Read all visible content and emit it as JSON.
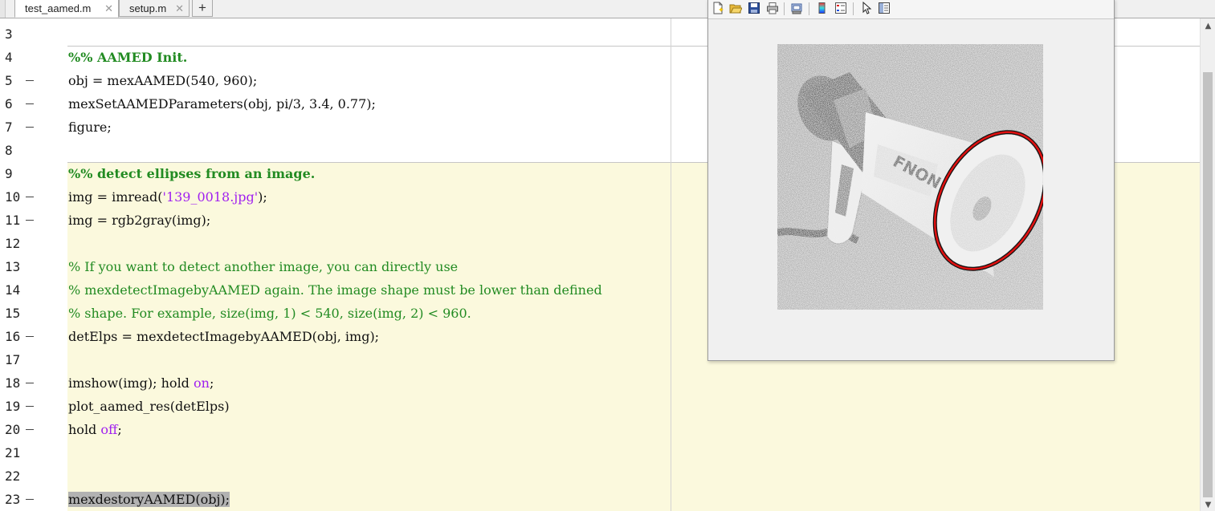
{
  "tabs": [
    {
      "label": "test_aamed.m",
      "close": "✕"
    },
    {
      "label": "setup.m",
      "close": "✕"
    }
  ],
  "new_tab_label": "+",
  "scroll": {
    "up": "▲",
    "down": "▼"
  },
  "lines": [
    {
      "num": "3",
      "dash": false,
      "parts": []
    },
    {
      "num": "4",
      "dash": false,
      "parts": [
        {
          "t": "%% AAMED Init.",
          "c": "sec"
        }
      ]
    },
    {
      "num": "5",
      "dash": true,
      "parts": [
        {
          "t": "obj = mexAAMED(540, 960);",
          "c": ""
        }
      ]
    },
    {
      "num": "6",
      "dash": true,
      "parts": [
        {
          "t": "mexSetAAMEDParameters(obj, pi/3, 3.4, 0.77);",
          "c": ""
        }
      ]
    },
    {
      "num": "7",
      "dash": true,
      "parts": [
        {
          "t": "figure;",
          "c": ""
        }
      ]
    },
    {
      "num": "8",
      "dash": false,
      "parts": []
    },
    {
      "num": "9",
      "dash": false,
      "parts": [
        {
          "t": "%% detect ellipses from an image.",
          "c": "sec"
        }
      ]
    },
    {
      "num": "10",
      "dash": true,
      "parts": [
        {
          "t": "img = imread(",
          "c": ""
        },
        {
          "t": "'139_0018.jpg'",
          "c": "str"
        },
        {
          "t": ");",
          "c": ""
        }
      ]
    },
    {
      "num": "11",
      "dash": true,
      "parts": [
        {
          "t": "img = rgb2gray(img);",
          "c": ""
        }
      ]
    },
    {
      "num": "12",
      "dash": false,
      "parts": []
    },
    {
      "num": "13",
      "dash": false,
      "parts": [
        {
          "t": "% If you want to detect another image, you can directly use",
          "c": "cmt"
        }
      ]
    },
    {
      "num": "14",
      "dash": false,
      "parts": [
        {
          "t": "% mexdetectImagebyAAMED again. The image shape must be lower than defined",
          "c": "cmt"
        }
      ]
    },
    {
      "num": "15",
      "dash": false,
      "parts": [
        {
          "t": "% shape. For example, size(img, 1) < 540, size(img, 2) < 960.",
          "c": "cmt"
        }
      ]
    },
    {
      "num": "16",
      "dash": true,
      "parts": [
        {
          "t": "detElps = mexdetectImagebyAAMED(obj, img);",
          "c": ""
        }
      ]
    },
    {
      "num": "17",
      "dash": false,
      "parts": []
    },
    {
      "num": "18",
      "dash": true,
      "parts": [
        {
          "t": "imshow(img); hold ",
          "c": ""
        },
        {
          "t": "on",
          "c": "kw"
        },
        {
          "t": ";",
          "c": ""
        }
      ]
    },
    {
      "num": "19",
      "dash": true,
      "parts": [
        {
          "t": "plot_aamed_res(detElps)",
          "c": ""
        }
      ]
    },
    {
      "num": "20",
      "dash": true,
      "parts": [
        {
          "t": "hold ",
          "c": ""
        },
        {
          "t": "off",
          "c": "kw"
        },
        {
          "t": ";",
          "c": ""
        }
      ]
    },
    {
      "num": "21",
      "dash": false,
      "parts": []
    },
    {
      "num": "22",
      "dash": false,
      "parts": []
    },
    {
      "num": "23",
      "dash": true,
      "parts": [
        {
          "t": "mexdestoryAAMED(obj);",
          "c": "sel"
        }
      ]
    }
  ],
  "figure_toolbar": [
    "new-figure-icon",
    "open-file-icon",
    "save-icon",
    "print-icon",
    "print-preview-icon",
    "colorbar-icon",
    "legend-icon",
    "pointer-icon",
    "property-editor-icon"
  ],
  "colors": {
    "section": "#228b22",
    "comment": "#228b22",
    "string": "#a020f0",
    "keyword": "#a020f0",
    "cell_bg": "#fbf9dd",
    "ellipse": "#e01010"
  }
}
